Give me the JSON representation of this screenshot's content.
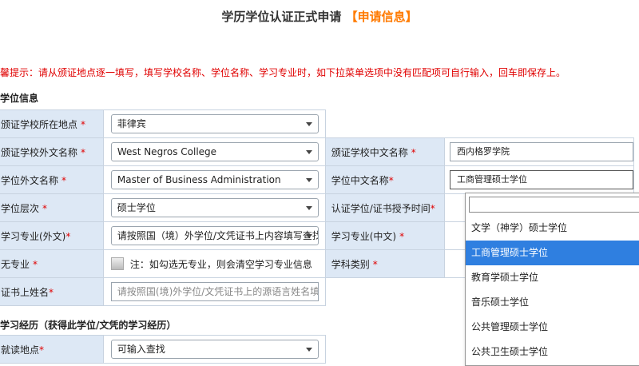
{
  "header": {
    "title": "学历学位认证正式申请",
    "title_highlight": "【申请信息】"
  },
  "notice": "馨提示：请从颁证地点逐一填写，填写学校名称、学位名称、学习专业时，如下拉菜单选项中没有匹配项可自行输入，回车即保存上。",
  "sections": {
    "degree_info": "学位信息",
    "study_history": "学习经历（获得此学位/文凭的学习经历）"
  },
  "form": {
    "school_location": {
      "label": "颁证学校所在地点",
      "req": "*",
      "value": "菲律宾"
    },
    "school_foreign_name": {
      "label": "颁证学校外文名称",
      "req": "*",
      "value": "West Negros College"
    },
    "school_chinese_name": {
      "label": "颁证学校中文名称",
      "req": "*",
      "value": "西内格罗学院"
    },
    "degree_foreign_name": {
      "label": "学位外文名称",
      "req": "*",
      "value": "Master of Business Administration"
    },
    "degree_chinese_name": {
      "label": "学位中文名称",
      "req": "*",
      "value": "工商管理硕士学位"
    },
    "degree_level": {
      "label": "学位层次",
      "req": "*",
      "value": "硕士学位"
    },
    "award_time": {
      "label": "认证学位/证书授予时间",
      "req": "*"
    },
    "major_foreign": {
      "label": "学习专业(外文)",
      "req": "*",
      "value": "请按照国（境）外学位/文凭证书上内容填写查找"
    },
    "major_chinese": {
      "label": "学习专业(中文)",
      "req": "*"
    },
    "no_major": {
      "label": "无专业",
      "req": "*",
      "text": "注：如勾选无专业，则会清空学习专业信息"
    },
    "discipline": {
      "label": "学科类别",
      "req": "*"
    },
    "cert_name": {
      "label": "证书上姓名",
      "req": "*",
      "placeholder": "请按照国(境)外学位/文凭证书上的源语言姓名填写"
    },
    "study_location": {
      "label": "就读地点",
      "req": "*",
      "value": "可输入查找"
    }
  },
  "dropdown": {
    "options": [
      "文学（神学）硕士学位",
      "工商管理硕士学位",
      "教育学硕士学位",
      "音乐硕士学位",
      "公共管理硕士学位",
      "公共卫生硕士学位"
    ],
    "selected_index": 1
  },
  "colors": {
    "label_bg": "#dde8f5",
    "accent": "#ff7a00",
    "warning": "#e00000",
    "selected": "#2f7fe0"
  }
}
